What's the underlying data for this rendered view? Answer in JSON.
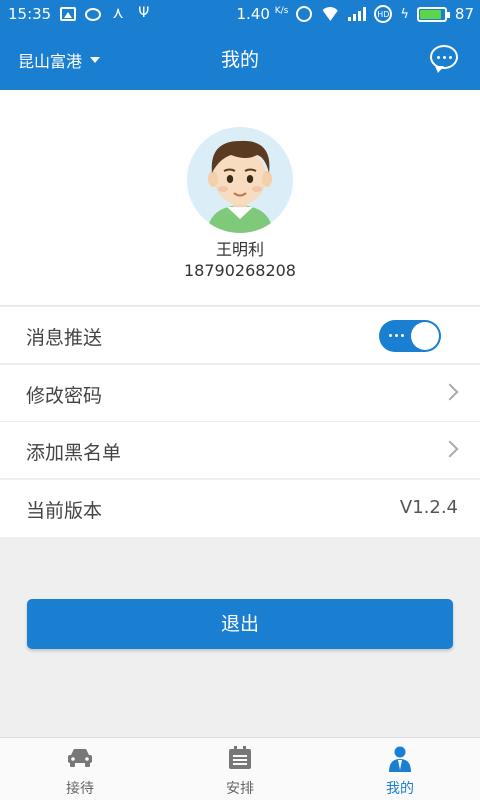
{
  "status_bar": {
    "time": "15:35",
    "net_speed": "1.40",
    "net_speed_unit": "K/s",
    "network_type": "4G",
    "hd_label": "HD",
    "battery_level": "87",
    "battery_fill": 0.87,
    "battery_color": "#5dd54b"
  },
  "header": {
    "location": "昆山富港",
    "title": "我的",
    "chat_icon": "chat-bubble-icon"
  },
  "profile": {
    "avatar_icon": "user-avatar",
    "name": "王明利",
    "phone": "18790268208"
  },
  "settings": [
    {
      "label": "消息推送",
      "control": "toggle",
      "on": true
    },
    {
      "label": "修改密码",
      "control": "chevron"
    },
    {
      "label": "添加黑名单",
      "control": "chevron"
    },
    {
      "label": "当前版本",
      "control": "value",
      "value": "V1.2.4"
    }
  ],
  "logout_label": "退出",
  "tabs": [
    {
      "label": "接待",
      "icon": "car-icon",
      "active": false
    },
    {
      "label": "安排",
      "icon": "calendar-icon",
      "active": false
    },
    {
      "label": "我的",
      "icon": "person-icon",
      "active": true
    }
  ],
  "colors": {
    "primary": "#1a7fd0",
    "background": "#efefef",
    "tab_inactive": "#666666"
  }
}
